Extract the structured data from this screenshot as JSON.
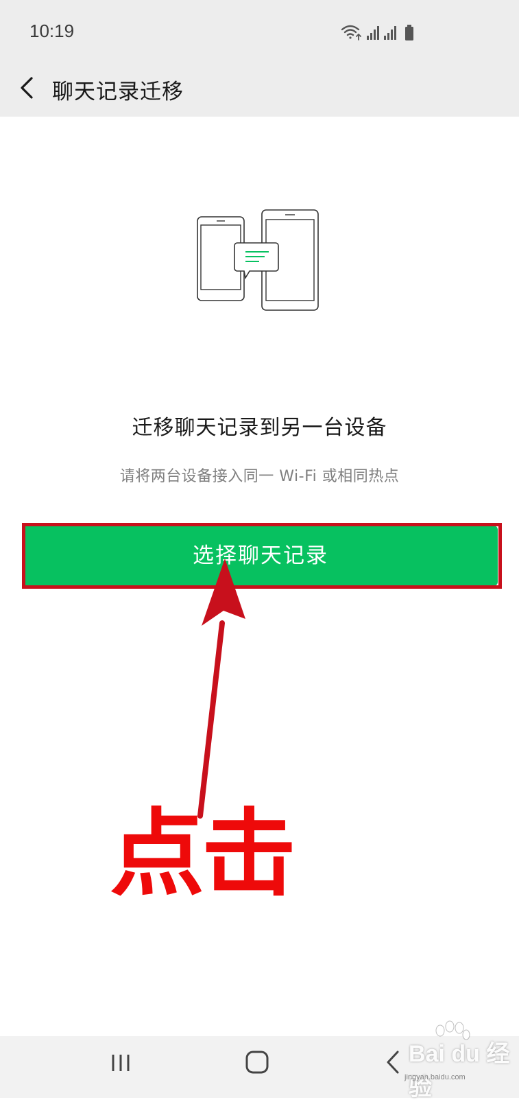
{
  "status_bar": {
    "time": "10:19",
    "icons": [
      "wifi-icon",
      "signal-icon",
      "signal-icon",
      "battery-icon"
    ]
  },
  "app_bar": {
    "title": "聊天记录迁移",
    "back_icon": "chevron-left-icon"
  },
  "main": {
    "illustration": "phones-transfer-icon",
    "heading": "迁移聊天记录到另一台设备",
    "subtext": "请将两台设备接入同一 Wi-Fi 或相同热点",
    "button_label": "选择聊天记录"
  },
  "annotation": {
    "label": "点击"
  },
  "nav_bar": {
    "icons": [
      "recent-apps-icon",
      "home-icon",
      "back-icon"
    ]
  },
  "watermark": {
    "text": "Bai du 经验",
    "sub": "jingyan.baidu.com"
  },
  "colors": {
    "primary_green": "#07c160",
    "annotation_red": "#ee0a0a",
    "highlight_border": "#c8101c",
    "bar_gray": "#ededed"
  }
}
